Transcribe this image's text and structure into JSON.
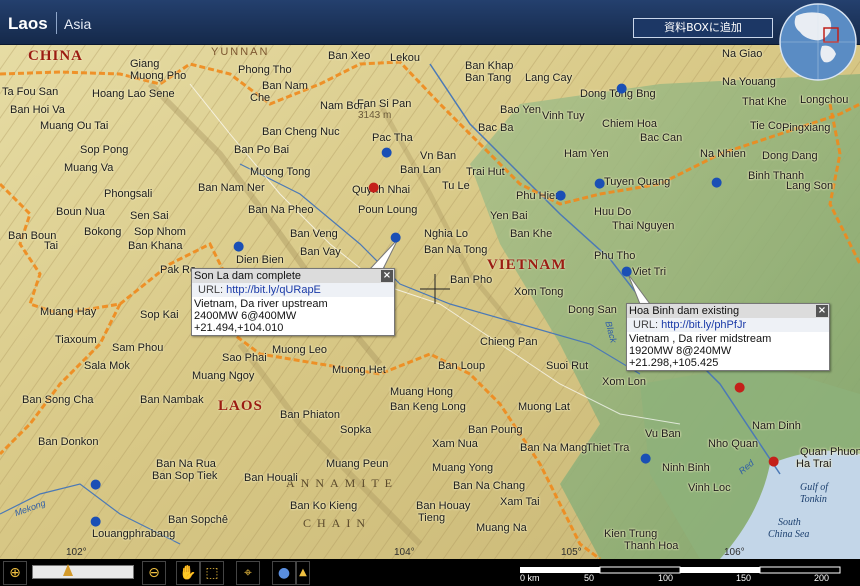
{
  "header": {
    "country": "Laos",
    "region": "Asia",
    "add_box_label": "資料BOXに追加"
  },
  "colors": {
    "header_bg": "#1b3461",
    "border_orange": "#f08a1c",
    "terrain_light": "#e0d59a",
    "lowland_green": "#8fb07a",
    "sea": "#c3d6e8"
  },
  "map": {
    "countries": [
      "CHINA",
      "VIETNAM",
      "LAOS"
    ],
    "province": "YUNNAN",
    "range": [
      "ANNAMITE",
      "CHAIN"
    ],
    "peak": {
      "name": "Fan Si Pan",
      "elevation": "3143 m"
    },
    "sea": {
      "gulf_line1": "Gulf of",
      "gulf_line2": "Tonkin",
      "china_line1": "South",
      "china_line2": "China Sea"
    },
    "rivers": [
      "Mekong",
      "Black",
      "Red"
    ],
    "coords": [
      "102°",
      "104°",
      "105°",
      "106°"
    ],
    "places": [
      "Giang",
      "Muong Pho",
      "Phong Tho",
      "Ban Xeo",
      "Lekou",
      "Ban Khap",
      "Ban Tang",
      "Lang Cay",
      "Na Giao",
      "Ta Fou San",
      "Hoang Lao Sene",
      "Ban Nam",
      "Che",
      "Dong Tong Bng",
      "Na Youang",
      "Ban Hoi Va",
      "Nam Bon",
      "Fan Si Pan",
      "Bao Yen",
      "Vinh Tuy",
      "That Khe",
      "Longchou",
      "Muang Ou Tai",
      "Ban Cheng Nuc",
      "Bac Ba",
      "Chiem Hoa",
      "Bac Can",
      "Tie Co",
      "Pingxiang",
      "Sop Pong",
      "Ban Po Bai",
      "Pac Tha",
      "Vn Ban",
      "Ham Yen",
      "Na Nhien",
      "Dong Dang",
      "Muang Va",
      "Muong Tong",
      "Ban Lan",
      "Trai Hut",
      "Binh Thanh",
      "Phongsali",
      "Ban Nam Ner",
      "Quynh Nhai",
      "Tu Le",
      "Phu Hien",
      "Tuyen Quang",
      "Lang Son",
      "Boun Nua",
      "Ban Na Pheo",
      "Poun Loung",
      "Yen Bai",
      "Huu Do",
      "Sen Sai",
      "Bokong",
      "Sop Nhom",
      "Ban Veng",
      "Nghia Lo",
      "Ban Khe",
      "Thai Nguyen",
      "Ban Boun",
      "Tai",
      "Ban Khana",
      "Dien Bien",
      "Ban Vay",
      "Ban Na Tong",
      "Phu Tho",
      "Viet Tri",
      "Pak Ro",
      "Ban Pho",
      "Muang Hay",
      "Sop Kai",
      "Xom Tong",
      "Dong San",
      "Tiaxoum",
      "Sam Phou",
      "Muong Leo",
      "Chieng Pan",
      "Sala Mok",
      "Sao Phai",
      "Muong Het",
      "Ban Loup",
      "Suoi Rut",
      "Xom Lon",
      "Muang Ngoy",
      "Muang Hong",
      "Ban Song Cha",
      "Ban Nambak",
      "Ban Keng Long",
      "Muong Lat",
      "Ban Phiaton",
      "Sopka",
      "Ban Poung",
      "Vu Ban",
      "Nam Dinh",
      "Ban Donkon",
      "Xam Nua",
      "Nho Quan",
      "Ban Na Mang",
      "Thiet Tra",
      "Quan Phuong",
      "Ha Trai",
      "Ban Na Rua",
      "Muang Peun",
      "Muang Yong",
      "Ninh Binh",
      "Ban Sop Tiek",
      "Ban Houali",
      "Ban Na Chang",
      "Vinh Loc",
      "Ban Ko Kieng",
      "Ban Houay",
      "Tieng",
      "Xam Tai",
      "Ban Sopchê",
      "Louangphrabang",
      "Muang Na",
      "Kien Trung",
      "Thanh Hoa"
    ]
  },
  "popups": [
    {
      "title": "Son La dam complete",
      "url_label": "URL:",
      "url": "http://bit.ly/qURapE",
      "line1": "Vietnam, Da river  upstream",
      "line2": "2400MW 6@400MW",
      "line3": "+21.494,+104.010"
    },
    {
      "title": "Hoa Binh dam existing",
      "url_label": "URL:",
      "url": "http://bit.ly/phPfJr",
      "line1": "Vietnam , Da river midstream",
      "line2": "1920MW 8@240MW",
      "line3": "+21.298,+105.425"
    }
  ],
  "toolbar": {
    "zoom_in_icon": "zoom-in-icon",
    "zoom_out_icon": "zoom-out-icon",
    "zoom_level": 0.3,
    "scale_labels": [
      "0 km",
      "50",
      "100",
      "150",
      "200"
    ]
  }
}
